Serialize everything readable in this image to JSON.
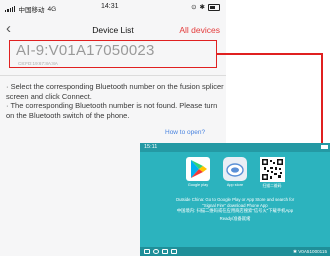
{
  "phone": {
    "statusbar": {
      "carrier": "中国移动",
      "network": "4G",
      "time": "14:31"
    },
    "navbar": {
      "title": "Device List",
      "action_label": "All devices"
    },
    "device": {
      "name": "AI-9:V01A17050023",
      "mac": "C8:FD:19:67:8A:8A"
    },
    "instructions": [
      "· Select the corresponding Bluetooth number on the fusion splicer screen and click Connect.",
      "· The corresponding Bluetooth number is not found. Please turn on the Bluetooth switch of the phone."
    ],
    "howto_link": "How to open?"
  },
  "splicer": {
    "time": "15:11",
    "apps": [
      {
        "label": "Google play",
        "icon": "google-play-icon"
      },
      {
        "label": "App store",
        "icon": "app-store-icon"
      },
      {
        "label": "扫描二维码",
        "icon": "qr-code-icon"
      }
    ],
    "text_lines": [
      "Outside China: Go to Google Play or App Store and search for",
      "\"Signal Fire\" download Phone App",
      "中国境内: 扫描二维码或在应用商店搜索\"信号火\"下载手机App",
      "Ready/准备就绪"
    ],
    "bt_id": "V0A51000115"
  },
  "colors": {
    "highlight": "#e02020",
    "splicer_bg": "#2cb3be",
    "link": "#4a84e0"
  }
}
